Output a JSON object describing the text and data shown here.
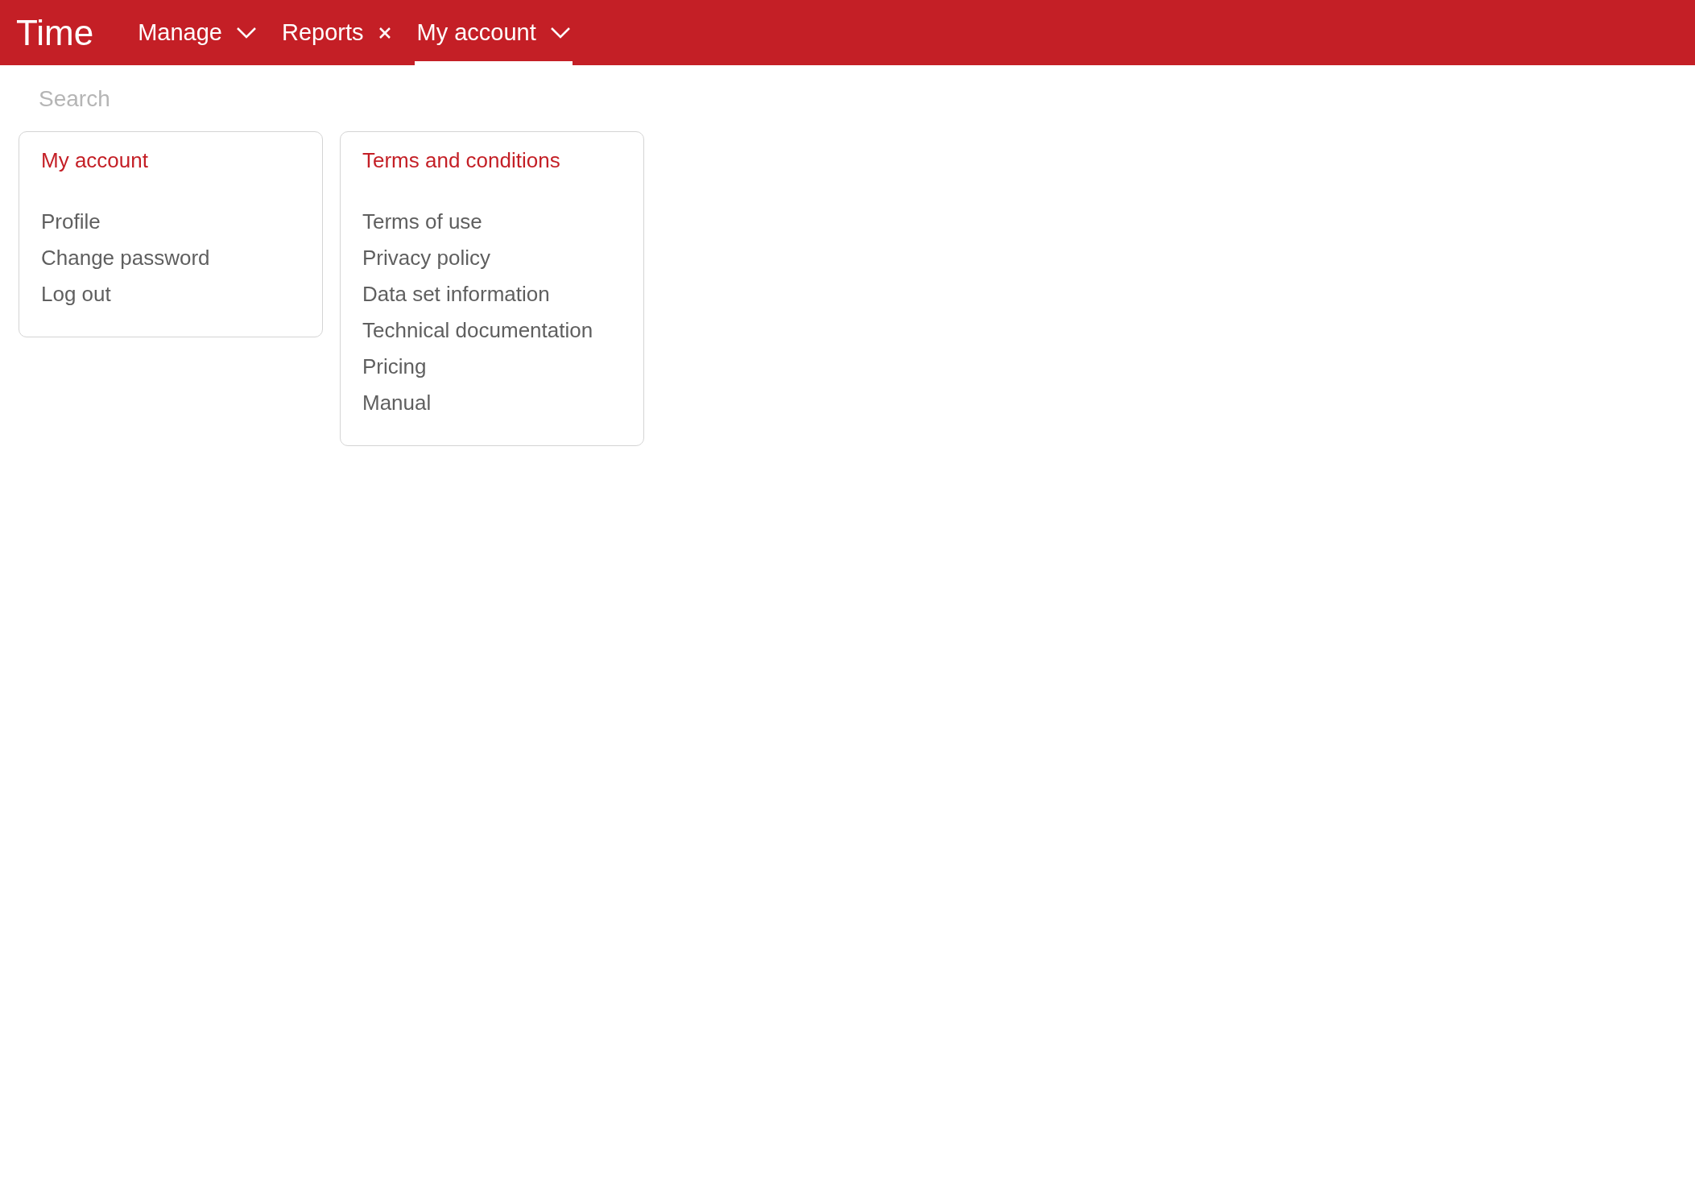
{
  "app": {
    "title": "Time"
  },
  "tabs": [
    {
      "label": "Manage",
      "kind": "dropdown",
      "selected": false
    },
    {
      "label": "Reports",
      "kind": "closable",
      "selected": false
    },
    {
      "label": "My account",
      "kind": "dropdown",
      "selected": true
    }
  ],
  "search": {
    "placeholder": "Search"
  },
  "cards": [
    {
      "title": "My account",
      "items": [
        "Profile",
        "Change password",
        "Log out"
      ]
    },
    {
      "title": "Terms and conditions",
      "items": [
        "Terms of use",
        "Privacy policy",
        "Data set information",
        "Technical documentation",
        "Pricing",
        "Manual"
      ]
    }
  ]
}
